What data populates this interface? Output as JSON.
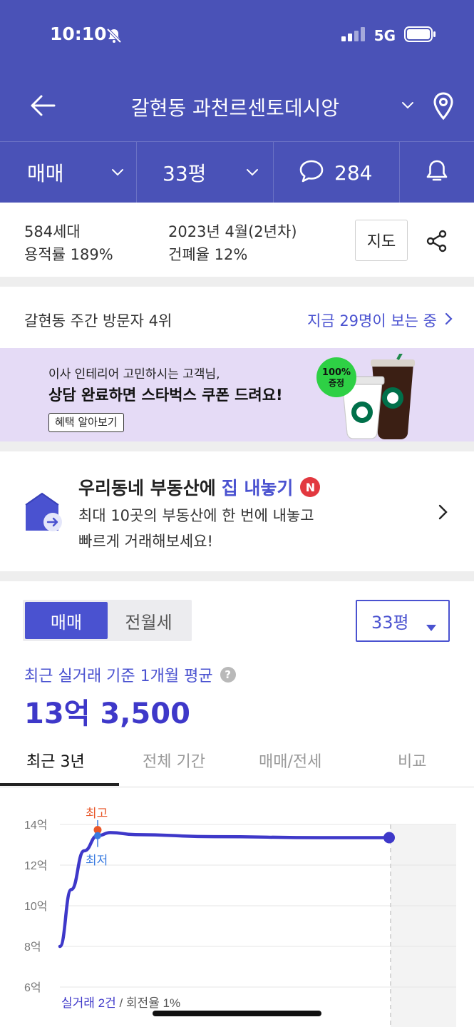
{
  "status_bar": {
    "time": "10:10",
    "network": "5G"
  },
  "header": {
    "title": "갈현동 과천르센토데시앙"
  },
  "subbar": {
    "deal_type": "매매",
    "size": "33평",
    "comment_count": "284"
  },
  "info": {
    "households": "584세대",
    "floor_area_ratio": "용적률 189%",
    "built": "2023년 4월(2년차)",
    "coverage_ratio": "건폐율 12%",
    "map_button": "지도"
  },
  "visitors": {
    "rank": "갈현동 주간 방문자 4위",
    "watching": "지금 29명이 보는 중"
  },
  "banner": {
    "line1": "이사 인테리어 고민하시는 고객님,",
    "line2": "상담 완료하면 스타벅스 쿠폰 드려요!",
    "button": "혜택 알아보기",
    "badge_line1": "100%",
    "badge_line2": "증정"
  },
  "promo": {
    "title_prefix": "우리동네 부동산에",
    "title_highlight": "집 내놓기",
    "badge": "N",
    "desc_line1": "최대 10곳의 부동산에 한 번에 내놓고",
    "desc_line2": "빠르게 거래해보세요!"
  },
  "price_section": {
    "segment": [
      "매매",
      "전월세"
    ],
    "size_select": "33평",
    "avg_label": "최근 실거래 기준 1개월 평균",
    "avg_price": "13억 3,500",
    "tabs": [
      "최근 3년",
      "전체 기간",
      "매매/전세",
      "비교"
    ]
  },
  "colors": {
    "brand": "#4A52B7",
    "accent": "#4A52D0",
    "line": "#3E38C9",
    "high": "#E8572A",
    "low": "#3A7BE0"
  },
  "chart_data": {
    "type": "line",
    "y_ticks": [
      "14억",
      "12억",
      "10억",
      "8억",
      "6억"
    ],
    "ylim": [
      6,
      14.5
    ],
    "unit": "억",
    "series": [
      {
        "values": [
          8.0,
          10.8,
          12.7,
          13.45,
          13.6,
          13.5,
          13.4,
          13.35,
          13.35
        ]
      }
    ],
    "marker_high_label": "최고",
    "marker_low_label": "최저",
    "footer_trades": "실거래 2건",
    "footer_turnover": " / 회전율 1%"
  }
}
